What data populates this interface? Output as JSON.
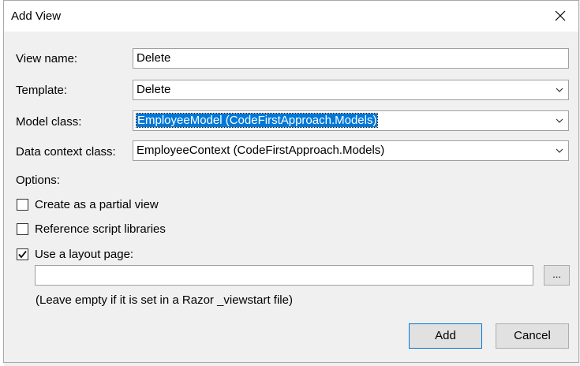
{
  "dialog": {
    "title": "Add View",
    "close_glyph": "×"
  },
  "form": {
    "view_name": {
      "label": "View name:",
      "value": "Delete"
    },
    "template": {
      "label": "Template:",
      "value": "Delete"
    },
    "model_class": {
      "label": "Model class:",
      "value": "EmployeeModel (CodeFirstApproach.Models)"
    },
    "data_context_class": {
      "label": "Data context class:",
      "value": "EmployeeContext (CodeFirstApproach.Models)"
    }
  },
  "options": {
    "label": "Options:",
    "partial_view": {
      "label": "Create as a partial view",
      "checked": false
    },
    "script_libraries": {
      "label": "Reference script libraries",
      "checked": false
    },
    "layout_page": {
      "label": "Use a layout page:",
      "checked": true,
      "value": ""
    },
    "browse_label": "...",
    "hint": "(Leave empty if it is set in a Razor _viewstart file)"
  },
  "buttons": {
    "add": "Add",
    "cancel": "Cancel"
  },
  "icons": {
    "close": "close-icon",
    "dropdown": "chevron-down-icon",
    "check": "checkmark-icon"
  },
  "colors": {
    "accent": "#0078d7",
    "dialog_bg": "#f0f0f0",
    "title_bg": "#ffffff"
  }
}
